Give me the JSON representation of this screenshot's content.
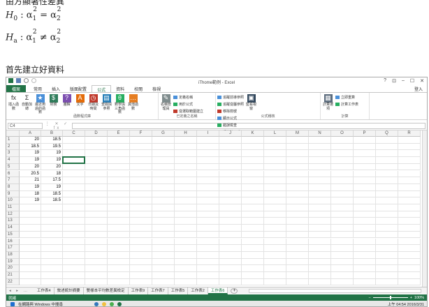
{
  "document": {
    "heading_cut": "由方顯著性差異",
    "h0": {
      "symbol": "H",
      "sub": "0",
      "colon": " : ",
      "lhs": "α",
      "lhs_sub": "1",
      "lhs_sup": "2",
      "op": " = ",
      "rhs": "α",
      "rhs_sub": "2",
      "rhs_sup": "2"
    },
    "ha": {
      "symbol": "H",
      "sub": "a",
      "colon": " : ",
      "lhs": "α",
      "lhs_sub": "1",
      "lhs_sup": "2",
      "op": " ≠ ",
      "rhs": "α",
      "rhs_sub": "2",
      "rhs_sup": "2"
    },
    "paragraph": "首先建立好資料"
  },
  "excel": {
    "title": "iThome範例 - Excel",
    "window_controls": [
      "?",
      "⊡",
      "–",
      "☐",
      "✕"
    ],
    "user": "登入",
    "tabs": {
      "file": "檔案",
      "items": [
        "常用",
        "插入",
        "版面配置",
        "公式",
        "資料",
        "校閱",
        "檢視"
      ],
      "active_index": 3
    },
    "ribbon": {
      "groups": [
        {
          "label": "函數程式庫",
          "big": [
            {
              "label": "插入函數",
              "icon": "fx-icon",
              "color": "#ffffff",
              "glyph": "fx"
            },
            {
              "label": "自動加總",
              "icon": "sigma-icon",
              "color": "#ffffff",
              "glyph": "Σ"
            },
            {
              "label": "最近用過的函數",
              "icon": "recent-function-icon",
              "color": "#4a90d9",
              "glyph": "★"
            },
            {
              "label": "財務",
              "icon": "finance-icon",
              "color": "#2f7d5b",
              "glyph": "$"
            },
            {
              "label": "邏輯",
              "icon": "logic-icon",
              "color": "#7c4fb0",
              "glyph": "?"
            },
            {
              "label": "文字",
              "icon": "text-icon",
              "color": "#e46c0a",
              "glyph": "A"
            },
            {
              "label": "日期及時間",
              "icon": "datetime-icon",
              "color": "#c0392b",
              "glyph": "◷"
            },
            {
              "label": "查閱與參照",
              "icon": "lookup-icon",
              "color": "#2980b9",
              "glyph": "▤"
            },
            {
              "label": "數學與三角函數",
              "icon": "math-icon",
              "color": "#27ae60",
              "glyph": "θ"
            },
            {
              "label": "其他函數",
              "icon": "more-functions-icon",
              "color": "#e67e22",
              "glyph": "…"
            }
          ]
        },
        {
          "label": "已定義之名稱",
          "big": [
            {
              "label": "名稱管理員",
              "icon": "name-manager-icon",
              "color": "#7f8c8d",
              "glyph": "✎"
            }
          ],
          "small": [
            "定義名稱",
            "用於公式",
            "從選取範圍建立"
          ]
        },
        {
          "label": "公式稽核",
          "small": [
            "追蹤前導參照",
            "追蹤從屬參照",
            "移除箭號",
            "顯示公式",
            "錯誤檢查",
            "評估值公式"
          ],
          "big": [
            {
              "label": "監看視窗",
              "icon": "watch-window-icon",
              "color": "#34495e",
              "glyph": "▣"
            }
          ]
        },
        {
          "label": "計算",
          "big": [
            {
              "label": "計算選項",
              "icon": "calc-options-icon",
              "color": "#5d6d7e",
              "glyph": "▦"
            }
          ],
          "small": [
            "立即重算",
            "計算工作表"
          ]
        }
      ]
    },
    "formula_bar": {
      "name_box": "C4",
      "buttons": "⋮ ✕ ✓ fx",
      "value": ""
    },
    "columns": [
      "A",
      "B",
      "C",
      "D",
      "E",
      "F",
      "G",
      "H",
      "I",
      "J",
      "K",
      "L",
      "M",
      "N",
      "O",
      "P",
      "Q",
      "R"
    ],
    "rows": [
      "1",
      "2",
      "3",
      "4",
      "5",
      "6",
      "7",
      "8",
      "9",
      "10",
      "11",
      "12",
      "13",
      "14",
      "15",
      "16",
      "17",
      "18",
      "19",
      "20",
      "21",
      "22"
    ],
    "cells": [
      [
        "20",
        "18.5"
      ],
      [
        "18.5",
        "19.5"
      ],
      [
        "19",
        "19"
      ],
      [
        "19",
        "19"
      ],
      [
        "20",
        "20"
      ],
      [
        "20.5",
        "18"
      ],
      [
        "21",
        "17.5"
      ],
      [
        "19",
        "19"
      ],
      [
        "18",
        "18.5"
      ],
      [
        "19",
        "18.5"
      ]
    ],
    "selected_cell": "C4",
    "sheets": [
      "工作表4",
      "敘述統計摘要",
      "雙樣本平均數差異檢定",
      "工作表9",
      "工作表7",
      "工作表5",
      "工作表2",
      "工作表6"
    ],
    "active_sheet_index": 7,
    "status": {
      "left": "就緒",
      "zoom": "100%"
    },
    "taskbar": {
      "search": "在網路與 Windows 中搜尋",
      "time": "上午 04:54",
      "date": "2016/3/31"
    },
    "colors": {
      "accent": "#217346",
      "header_bg": "#f3f3f3",
      "grid_line": "#e3e3e3"
    }
  }
}
